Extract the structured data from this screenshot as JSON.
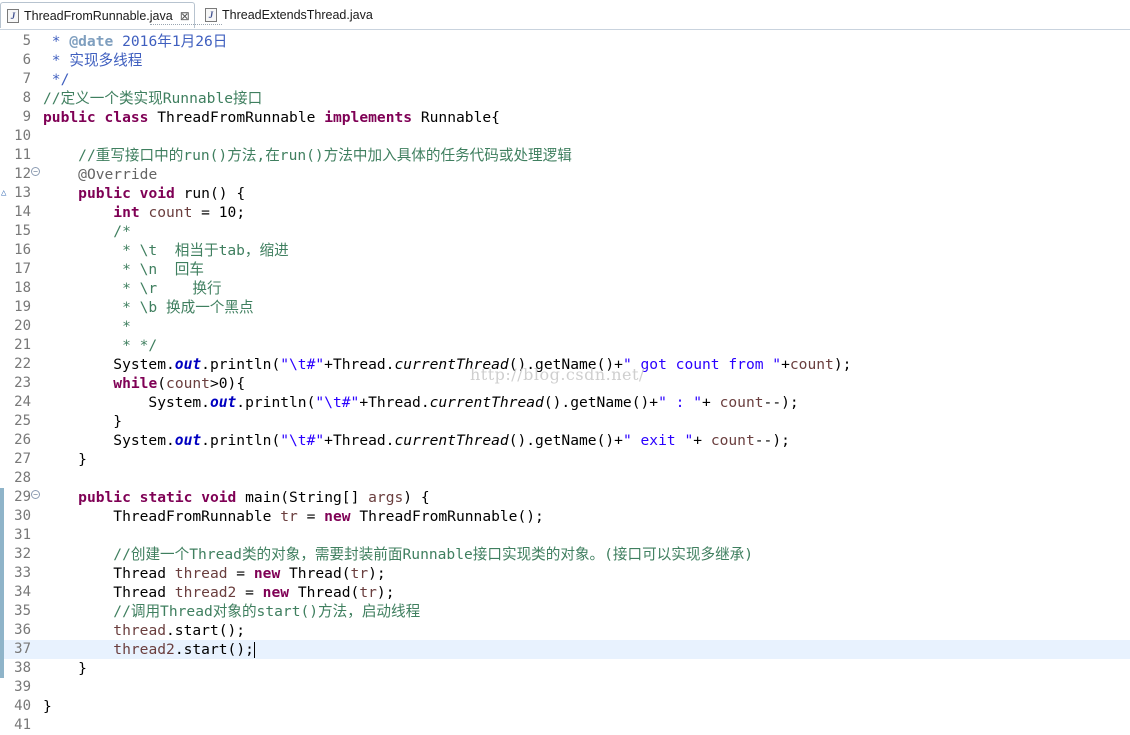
{
  "tabs": [
    {
      "label": "ThreadFromRunnable.java",
      "icon": "java-file-icon",
      "active": true
    },
    {
      "label": "ThreadExtendsThread.java",
      "icon": "java-file-icon",
      "active": false
    }
  ],
  "tab_close_glyph": "⊠",
  "watermark": "http://blog.csdn.net/",
  "current_line": 37,
  "lines": [
    {
      "n": "5",
      "t": [
        [
          " * ",
          "jd"
        ],
        [
          "@date",
          "jdt"
        ],
        [
          " 2016年1月26日",
          "jd"
        ]
      ]
    },
    {
      "n": "6",
      "t": [
        [
          " * 实现多线程",
          "jd"
        ]
      ]
    },
    {
      "n": "7",
      "t": [
        [
          " */",
          "jd"
        ]
      ]
    },
    {
      "n": "8",
      "t": [
        [
          "//定义一个类实现Runnable接口",
          "cm"
        ]
      ]
    },
    {
      "n": "9",
      "t": [
        [
          "public",
          "kw"
        ],
        [
          " ",
          ""
        ],
        [
          "class",
          "kw"
        ],
        [
          " ThreadFromRunnable ",
          ""
        ],
        [
          "implements",
          "kw"
        ],
        [
          " Runnable{",
          ""
        ]
      ]
    },
    {
      "n": "10",
      "t": []
    },
    {
      "n": "11",
      "t": [
        [
          "    ",
          ""
        ],
        [
          "//重写接口中的run()方法,在run()方法中加入具体的任务代码或处理逻辑",
          "cm"
        ]
      ]
    },
    {
      "n": "12",
      "t": [
        [
          "    ",
          ""
        ],
        [
          "@Override",
          "ann"
        ]
      ]
    },
    {
      "n": "13",
      "t": [
        [
          "    ",
          ""
        ],
        [
          "public",
          "kw"
        ],
        [
          " ",
          ""
        ],
        [
          "void",
          "kw"
        ],
        [
          " run() {",
          ""
        ]
      ]
    },
    {
      "n": "14",
      "t": [
        [
          "        ",
          ""
        ],
        [
          "int",
          "kw"
        ],
        [
          " ",
          ""
        ],
        [
          "count",
          "var"
        ],
        [
          " = 10;",
          ""
        ]
      ]
    },
    {
      "n": "15",
      "t": [
        [
          "        ",
          ""
        ],
        [
          "/*",
          "cm"
        ]
      ]
    },
    {
      "n": "16",
      "t": [
        [
          "         * \\t  相当于tab，缩进",
          "cm"
        ]
      ]
    },
    {
      "n": "17",
      "t": [
        [
          "         * \\n  回车",
          "cm"
        ]
      ]
    },
    {
      "n": "18",
      "t": [
        [
          "         * \\r    换行",
          "cm"
        ]
      ]
    },
    {
      "n": "19",
      "t": [
        [
          "         * \\b 换成一个黑点",
          "cm"
        ]
      ]
    },
    {
      "n": "20",
      "t": [
        [
          "         *",
          "cm"
        ]
      ]
    },
    {
      "n": "21",
      "t": [
        [
          "         * */",
          "cm"
        ]
      ]
    },
    {
      "n": "22",
      "t": [
        [
          "        System.",
          ""
        ],
        [
          "out",
          "fld"
        ],
        [
          ".println(",
          ""
        ],
        [
          "\"\\t#\"",
          "st"
        ],
        [
          "+Thread.",
          ""
        ],
        [
          "currentThread",
          "ital"
        ],
        [
          "().getName()+",
          ""
        ],
        [
          "\" got count from \"",
          "st"
        ],
        [
          "+",
          ""
        ],
        [
          "count",
          "var"
        ],
        [
          ");",
          ""
        ]
      ]
    },
    {
      "n": "23",
      "t": [
        [
          "        ",
          ""
        ],
        [
          "while",
          "kw"
        ],
        [
          "(",
          ""
        ],
        [
          "count",
          "var"
        ],
        [
          ">0){",
          ""
        ]
      ]
    },
    {
      "n": "24",
      "t": [
        [
          "            System.",
          ""
        ],
        [
          "out",
          "fld"
        ],
        [
          ".println(",
          ""
        ],
        [
          "\"\\t#\"",
          "st"
        ],
        [
          "+Thread.",
          ""
        ],
        [
          "currentThread",
          "ital"
        ],
        [
          "().getName()+",
          ""
        ],
        [
          "\" : \"",
          "st"
        ],
        [
          "+ ",
          ""
        ],
        [
          "count",
          "var"
        ],
        [
          "--);",
          ""
        ]
      ]
    },
    {
      "n": "25",
      "t": [
        [
          "        }",
          ""
        ]
      ]
    },
    {
      "n": "26",
      "t": [
        [
          "        System.",
          ""
        ],
        [
          "out",
          "fld"
        ],
        [
          ".println(",
          ""
        ],
        [
          "\"\\t#\"",
          "st"
        ],
        [
          "+Thread.",
          ""
        ],
        [
          "currentThread",
          "ital"
        ],
        [
          "().getName()+",
          ""
        ],
        [
          "\" exit \"",
          "st"
        ],
        [
          "+ ",
          ""
        ],
        [
          "count",
          "var"
        ],
        [
          "--);",
          ""
        ]
      ]
    },
    {
      "n": "27",
      "t": [
        [
          "    }",
          ""
        ]
      ]
    },
    {
      "n": "28",
      "t": []
    },
    {
      "n": "29",
      "t": [
        [
          "    ",
          ""
        ],
        [
          "public",
          "kw"
        ],
        [
          " ",
          ""
        ],
        [
          "static",
          "kw"
        ],
        [
          " ",
          ""
        ],
        [
          "void",
          "kw"
        ],
        [
          " main(String[] ",
          ""
        ],
        [
          "args",
          "var"
        ],
        [
          ") {",
          ""
        ]
      ]
    },
    {
      "n": "30",
      "t": [
        [
          "        ThreadFromRunnable ",
          ""
        ],
        [
          "tr",
          "var"
        ],
        [
          " = ",
          ""
        ],
        [
          "new",
          "kw"
        ],
        [
          " ThreadFromRunnable();",
          ""
        ]
      ]
    },
    {
      "n": "31",
      "t": []
    },
    {
      "n": "32",
      "t": [
        [
          "        ",
          ""
        ],
        [
          "//创建一个Thread类的对象，需要封装前面Runnable接口实现类的对象。(接口可以实现多继承)",
          "cm"
        ]
      ]
    },
    {
      "n": "33",
      "t": [
        [
          "        Thread ",
          ""
        ],
        [
          "thread",
          "var"
        ],
        [
          " = ",
          ""
        ],
        [
          "new",
          "kw"
        ],
        [
          " Thread(",
          ""
        ],
        [
          "tr",
          "var"
        ],
        [
          ");",
          ""
        ]
      ]
    },
    {
      "n": "34",
      "t": [
        [
          "        Thread ",
          ""
        ],
        [
          "thread2",
          "var"
        ],
        [
          " = ",
          ""
        ],
        [
          "new",
          "kw"
        ],
        [
          " Thread(",
          ""
        ],
        [
          "tr",
          "var"
        ],
        [
          ");",
          ""
        ]
      ]
    },
    {
      "n": "35",
      "t": [
        [
          "        ",
          ""
        ],
        [
          "//调用Thread对象的start()方法，启动线程",
          "cm"
        ]
      ]
    },
    {
      "n": "36",
      "t": [
        [
          "        ",
          ""
        ],
        [
          "thread",
          "var"
        ],
        [
          ".start();",
          ""
        ]
      ]
    },
    {
      "n": "37",
      "t": [
        [
          "        ",
          ""
        ],
        [
          "thread2",
          "var"
        ],
        [
          ".start();",
          ""
        ]
      ]
    },
    {
      "n": "38",
      "t": [
        [
          "    }",
          ""
        ]
      ]
    },
    {
      "n": "39",
      "t": []
    },
    {
      "n": "40",
      "t": [
        [
          "}",
          ""
        ]
      ]
    },
    {
      "n": "41",
      "t": []
    }
  ],
  "fold_lines": [
    "12",
    "29"
  ],
  "override_marker_line": "13",
  "override_marker_glyph": "△",
  "fold_glyph": "−",
  "changed_lines": [
    "29",
    "30",
    "31",
    "32",
    "33",
    "34",
    "35",
    "36",
    "37",
    "38"
  ]
}
